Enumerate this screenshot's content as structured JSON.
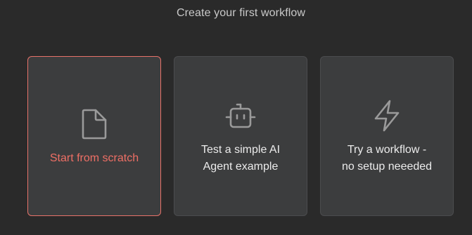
{
  "title": "Create your first workflow",
  "colors": {
    "background": "#2a2a2a",
    "card": "#3c3d3e",
    "accent": "#e7726a",
    "icon": "#9a9a9a"
  },
  "cards": [
    {
      "icon": "file-icon",
      "lines": [
        "Start from scratch"
      ],
      "selected": true
    },
    {
      "icon": "robot-icon",
      "lines": [
        "Test a simple AI",
        "Agent example"
      ],
      "selected": false
    },
    {
      "icon": "lightning-icon",
      "lines": [
        "Try a workflow -",
        "no setup neeeded"
      ],
      "selected": false
    }
  ]
}
